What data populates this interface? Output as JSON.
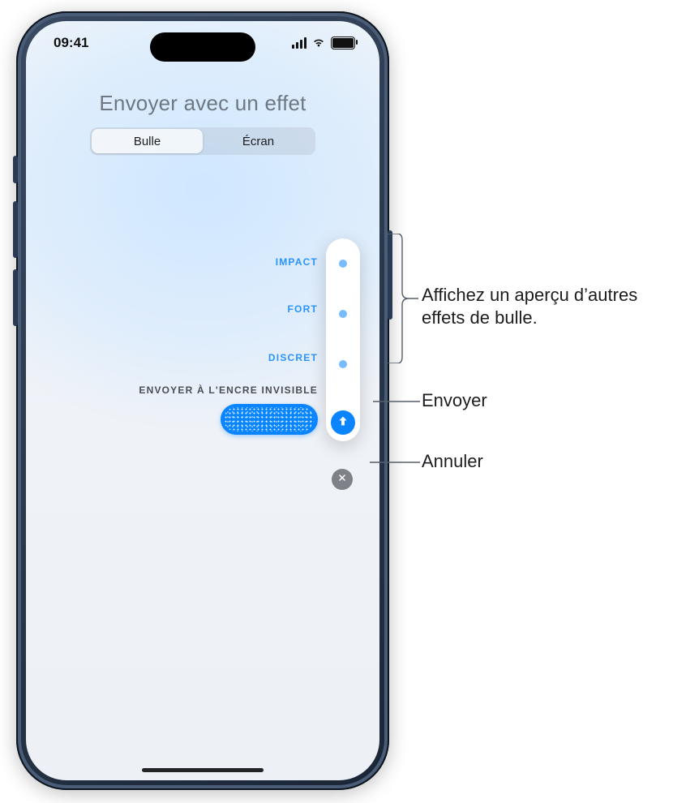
{
  "status": {
    "time": "09:41"
  },
  "header": {
    "title": "Envoyer avec un effet",
    "tabs": {
      "bubble": "Bulle",
      "screen": "Écran"
    },
    "active_tab": "bubble"
  },
  "effects": {
    "impact": "IMPACT",
    "loud": "FORT",
    "gentle": "DISCRET",
    "selected_label": "ENVOYER À L'ENCRE INVISIBLE"
  },
  "icons": {
    "send": "arrow-up-icon",
    "cancel": "close-icon"
  },
  "callouts": {
    "preview": "Affichez un aperçu d’autres effets de bulle.",
    "send": "Envoyer",
    "cancel": "Annuler"
  },
  "colors": {
    "accent": "#0a84ff",
    "cancel_bg": "#7e8188"
  }
}
